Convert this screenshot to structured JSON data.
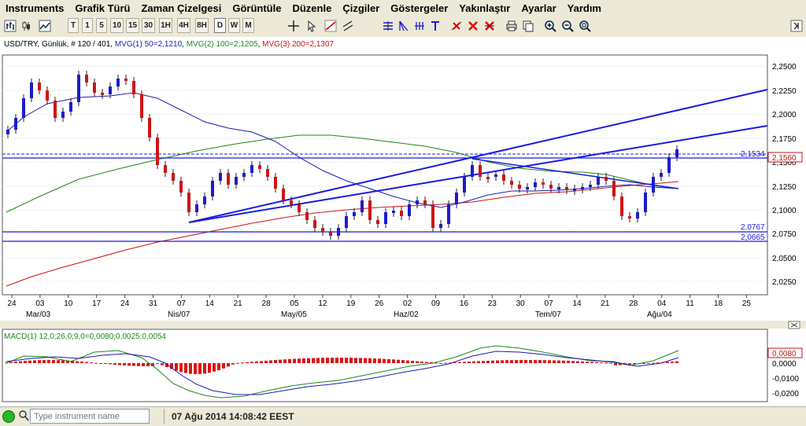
{
  "menu": [
    "Instruments",
    "Grafik Türü",
    "Zaman Çizelgesi",
    "Görüntüle",
    "Düzenle",
    "Çizgiler",
    "Göstergeler",
    "Yakınlaştır",
    "Ayarlar",
    "Yardım"
  ],
  "timeframes": [
    "T",
    "1",
    "5",
    "10",
    "15",
    "30",
    "1H",
    "4H",
    "8H",
    "D",
    "W",
    "M"
  ],
  "toolbar_icons": [
    "bar-chart-icon",
    "candle-chart-icon",
    "line-chart-icon",
    "crosshair-icon",
    "cursor-icon",
    "trendline-icon",
    "parallel-icon",
    "fib-icon",
    "fan-icon",
    "arc-icon",
    "text-icon",
    "delete-line-icon",
    "delete-all-icon",
    "print-icon",
    "copy-icon",
    "zoom-in-icon",
    "zoom-out-icon",
    "zoom-fit-icon"
  ],
  "main_chart": {
    "header_symbol": "USD/TRY",
    "header_info": ", Günlük, # 120 / 401, ",
    "ma1_label": "MVG(1) 50=2,1210",
    "ma2_label": "MVG(2) 100=2,1205",
    "ma3_label": "MVG(3) 200=2,1307",
    "price_labels": [
      "2,2500",
      "2,2250",
      "2,2000",
      "2,1750",
      "2,1500",
      "2,1250",
      "2,1000",
      "2,0750",
      "2,0500",
      "2,0250"
    ],
    "current_price": "2,1560",
    "level_labels": [
      "2,1534",
      "2,0767",
      "2,0665"
    ],
    "date_ticks": [
      "24",
      "03",
      "10",
      "17",
      "24",
      "31",
      "07",
      "14",
      "21",
      "28",
      "05",
      "12",
      "19",
      "26",
      "02",
      "09",
      "16",
      "23",
      "30",
      "07",
      "14",
      "21",
      "28",
      "04",
      "11",
      "18",
      "25"
    ],
    "month_labels": [
      "Mar/03",
      "Nis/07",
      "May/05",
      "Haz/02",
      "Tem/07",
      "Ağu/04"
    ]
  },
  "macd": {
    "label": "MACD(1) 12,0;26,0;9,0=0,0080;0,0025;0,0054",
    "axis_labels": [
      "0,0080",
      "0,0000",
      "-0,0100",
      "-0,0200"
    ]
  },
  "colors": {
    "ma1": "#1c1cb4",
    "ma2": "#1a8a1a",
    "ma3": "#c81414",
    "up_candle": "#1c1cd0",
    "down_candle": "#d01414",
    "trendline": "#1a1ae0"
  },
  "status": {
    "search_placeholder": "Type instrument name",
    "datetime": "07 Ağu 2014 14:08:42 EEST"
  }
}
